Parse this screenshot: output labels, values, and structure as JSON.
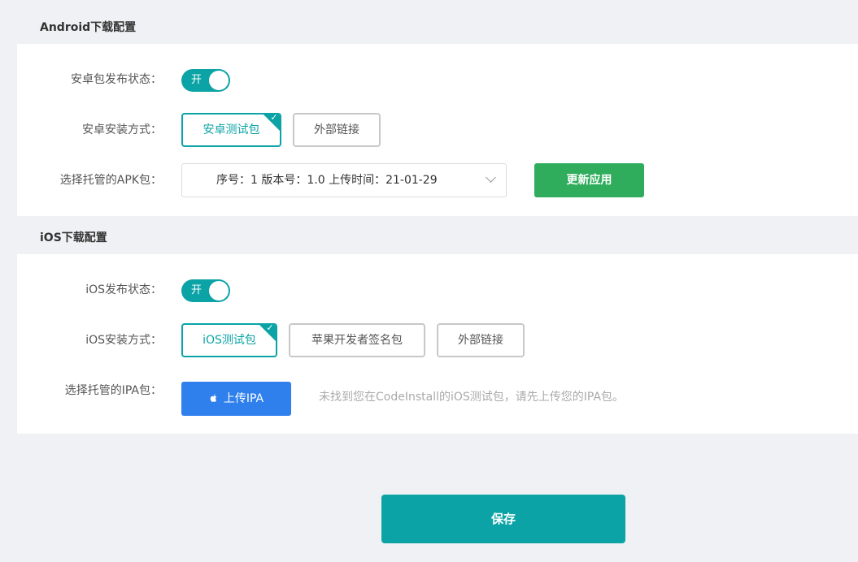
{
  "android": {
    "section_title": "Android下载配置",
    "status_label": "安卓包发布状态：",
    "toggle_text": "开",
    "install_label": "安卓安装方式：",
    "install_options": [
      "安卓测试包",
      "外部链接"
    ],
    "select_label": "选择托管的APK包：",
    "select_value": "序号：1  版本号：1.0  上传时间：21-01-29",
    "update_button": "更新应用"
  },
  "ios": {
    "section_title": "iOS下载配置",
    "status_label": "iOS发布状态：",
    "toggle_text": "开",
    "install_label": "iOS安装方式：",
    "install_options": [
      "iOS测试包",
      "苹果开发者签名包",
      "外部链接"
    ],
    "ipa_label": "选择托管的IPA包：",
    "upload_button": "上传IPA",
    "hint": "未找到您在CodeInstall的iOS测试包，请先上传您的IPA包。"
  },
  "save_button": "保存",
  "colors": {
    "accent": "#0ba3a6",
    "green": "#2fad5c",
    "blue": "#2f80ed"
  }
}
